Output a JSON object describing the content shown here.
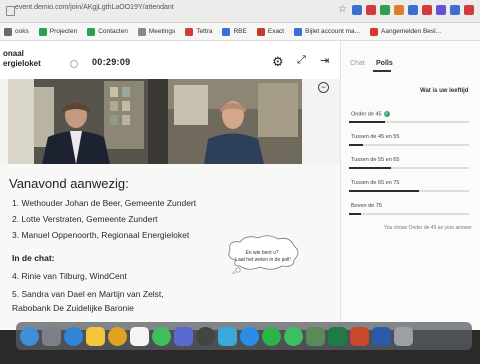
{
  "browser": {
    "url": "event.demio.com/join/AKgjLgthLaOO19Y/attendant",
    "bookmarks": [
      {
        "label": "ooks",
        "color": "#6b6b6b"
      },
      {
        "label": "Projecten",
        "color": "#2f9e4f"
      },
      {
        "label": "Contacten",
        "color": "#2f9e4f"
      },
      {
        "label": "Meetings",
        "color": "#888888"
      },
      {
        "label": "Tettra",
        "color": "#d23b3b"
      },
      {
        "label": "RBE",
        "color": "#3b6fd2"
      },
      {
        "label": "Exact",
        "color": "#c0392b"
      },
      {
        "label": "Bijlet account ma...",
        "color": "#3b6fd2"
      },
      {
        "label": "Aangemelden Besl...",
        "color": "#d23b3b"
      }
    ]
  },
  "header": {
    "brand_line1": "onaal",
    "brand_line2": "ergieloket",
    "timer": "00:29:09"
  },
  "agenda": {
    "title": "Vanavond aanwezig:",
    "items": [
      "1.   Wethouder Johan de Beer, Gemeente Zundert",
      "2.   Lotte Verstraten, Gemeente Zundert",
      "3.   Manuel Oppenoorth, Regionaal Energieloket"
    ],
    "chat_heading": "In de chat:",
    "chat_items": [
      "4.   Rinie van Tilburg, WindCent",
      "5.   Sandra van Dael en Martijn van Zelst,",
      "       Rabobank De Zuidelijke Baronie"
    ],
    "bubble_line1": "En wie bent u?",
    "bubble_line2": "Laat het weten in de poll!"
  },
  "panel": {
    "tab_chat": "Chat",
    "tab_polls": "Polls",
    "question": "Wat is uw leeftijd",
    "options": [
      {
        "label": "Onder de 45",
        "fill": 0.3,
        "selected": true
      },
      {
        "label": "Tussen de 45 en 55",
        "fill": 0.12,
        "selected": false
      },
      {
        "label": "Tussen de 55 en 65",
        "fill": 0.35,
        "selected": false
      },
      {
        "label": "Tussen de 65 en 75",
        "fill": 0.58,
        "selected": false
      },
      {
        "label": "Boven de 75",
        "fill": 0.1,
        "selected": false
      }
    ],
    "result": "You chose Onder de 45 as your answer"
  },
  "dock": {
    "apps": [
      {
        "name": "finder-icon",
        "color": "#3f8fd9"
      },
      {
        "name": "launchpad-icon",
        "color": "#7a7f88"
      },
      {
        "name": "safari-icon",
        "color": "#2f86d8"
      },
      {
        "name": "notes-icon",
        "color": "#f2c53b"
      },
      {
        "name": "chrome-icon",
        "color": "#e0a21f"
      },
      {
        "name": "calendar-icon",
        "color": "#f4f4f4"
      },
      {
        "name": "messages-icon",
        "color": "#3fbf5a"
      },
      {
        "name": "teams-icon",
        "color": "#5b6ad0"
      },
      {
        "name": "activity-icon",
        "color": "#444444"
      },
      {
        "name": "slack-icon",
        "color": "#3aa8d8"
      },
      {
        "name": "appstore-icon",
        "color": "#2a8ee8"
      },
      {
        "name": "spotify-icon",
        "color": "#2cb34a"
      },
      {
        "name": "whatsapp-icon",
        "color": "#3cbf60"
      },
      {
        "name": "vpn-icon",
        "color": "#5a8a5a"
      },
      {
        "name": "excel-icon",
        "color": "#1f7a44"
      },
      {
        "name": "powerpoint-icon",
        "color": "#c9472b"
      },
      {
        "name": "word-icon",
        "color": "#2b5aa8"
      },
      {
        "name": "trash-icon",
        "color": "#9aa0a6"
      }
    ]
  }
}
